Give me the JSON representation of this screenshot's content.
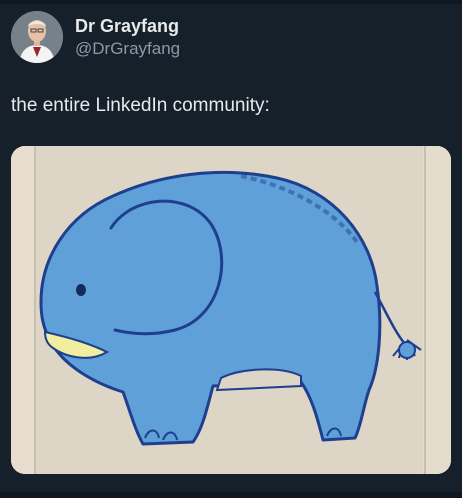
{
  "author": {
    "display_name": "Dr Grayfang",
    "handle": "@DrGrayfang",
    "avatar": "doctor-portrait"
  },
  "tweet": {
    "text": "the entire LinkedIn community:"
  },
  "media": {
    "subject": "blue-elephant-drawing",
    "colors": {
      "elephant_fill": "#5fa0d8",
      "outline": "#1e3f8e",
      "tusk": "#f2eea0",
      "paper": "#ddd5c5"
    }
  }
}
